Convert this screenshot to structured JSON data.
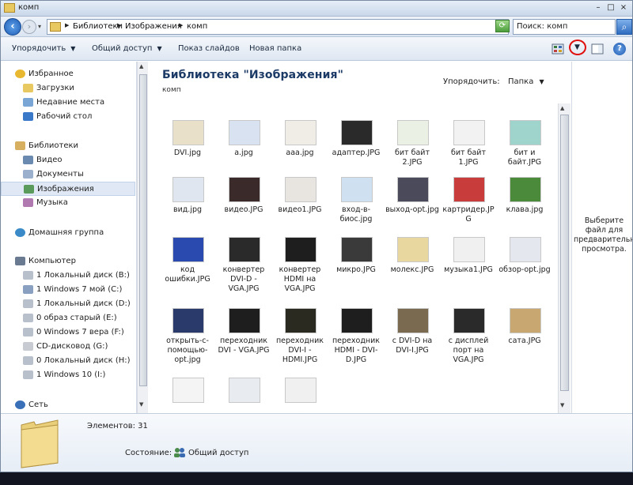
{
  "window": {
    "title": "комп"
  },
  "address": {
    "crumbs": [
      "Библиотеки",
      "Изображения",
      "комп"
    ],
    "search_placeholder": "Поиск: комп"
  },
  "toolbar": {
    "organize": "Упорядочить",
    "share": "Общий доступ",
    "slideshow": "Показ слайдов",
    "new_folder": "Новая папка"
  },
  "sidebar": {
    "items": [
      {
        "label": "Избранное",
        "icon": "star-icon"
      },
      {
        "label": "Загрузки",
        "icon": "downloads-folder-icon"
      },
      {
        "label": "Недавние места",
        "icon": "recent-places-icon"
      },
      {
        "label": "Рабочий стол",
        "icon": "desktop-icon"
      },
      {
        "label": "Библиотеки",
        "icon": "libraries-icon"
      },
      {
        "label": "Видео",
        "icon": "video-library-icon"
      },
      {
        "label": "Документы",
        "icon": "documents-library-icon"
      },
      {
        "label": "Изображения",
        "icon": "pictures-library-icon"
      },
      {
        "label": "Музыка",
        "icon": "music-library-icon"
      },
      {
        "label": "Домашняя группа",
        "icon": "homegroup-icon"
      },
      {
        "label": "Компьютер",
        "icon": "computer-icon"
      },
      {
        "label": "1 Локальный диск (B:)",
        "icon": "drive-icon"
      },
      {
        "label": "1 Windows 7 мой (C:)",
        "icon": "system-drive-icon"
      },
      {
        "label": "1 Локальный диск (D:)",
        "icon": "drive-icon"
      },
      {
        "label": "0 образ старый (E:)",
        "icon": "drive-icon"
      },
      {
        "label": "0 Windows 7 вера (F:)",
        "icon": "drive-icon"
      },
      {
        "label": "CD-дисковод (G:)",
        "icon": "cd-drive-icon"
      },
      {
        "label": "0 Локальный диск (H:)",
        "icon": "drive-icon"
      },
      {
        "label": "1 Windows 10 (I:)",
        "icon": "drive-icon"
      },
      {
        "label": "Сеть",
        "icon": "network-icon"
      }
    ]
  },
  "main": {
    "title": "Библиотека \"Изображения\"",
    "subtitle": "комп",
    "sort_label": "Упорядочить:",
    "sort_value": "Папка",
    "files": [
      {
        "name": "DVI.jpg",
        "thumb": "#e8e0c8"
      },
      {
        "name": "a.jpg",
        "thumb": "#d8e2f0"
      },
      {
        "name": "aaa.jpg",
        "thumb": "#f0ece6"
      },
      {
        "name": "адаптер.JPG",
        "thumb": "#2a2a2a"
      },
      {
        "name": "бит байт 2.JPG",
        "thumb": "#eaf0e4"
      },
      {
        "name": "бит байт 1.JPG",
        "thumb": "#f2f2f2"
      },
      {
        "name": "бит и байт.JPG",
        "thumb": "#9fd4cc"
      },
      {
        "name": "вид.jpg",
        "thumb": "#dfe6f0"
      },
      {
        "name": "видео.JPG",
        "thumb": "#3a2a2a"
      },
      {
        "name": "видео1.JPG",
        "thumb": "#e8e4e0"
      },
      {
        "name": "вход-в-биос.jpg",
        "thumb": "#cfe0f0"
      },
      {
        "name": "выход-opt.jpg",
        "thumb": "#4a4a5a"
      },
      {
        "name": "картридер.JPG",
        "thumb": "#c83c3c"
      },
      {
        "name": "клава.jpg",
        "thumb": "#4a8a3a"
      },
      {
        "name": "код ошибки.JPG",
        "thumb": "#2a4ab0"
      },
      {
        "name": "конвертер DVI-D - VGA.JPG",
        "thumb": "#2a2a2a"
      },
      {
        "name": "конвертер HDMI на VGA.JPG",
        "thumb": "#1e1e1e"
      },
      {
        "name": "микро.JPG",
        "thumb": "#3a3a3a"
      },
      {
        "name": "молекс.JPG",
        "thumb": "#e8d8a0"
      },
      {
        "name": "музыка1.JPG",
        "thumb": "#f0f0f0"
      },
      {
        "name": "обзор-opt.jpg",
        "thumb": "#e4e8ee"
      },
      {
        "name": "открыть-с-помощью-opt.jpg",
        "thumb": "#2a3a6a"
      },
      {
        "name": "переходник DVI - VGA.JPG",
        "thumb": "#1e1e1e"
      },
      {
        "name": "переходник DVI-I - HDMI.JPG",
        "thumb": "#2a2a20"
      },
      {
        "name": "переходник HDMI - DVI-D.JPG",
        "thumb": "#1e1e1e"
      },
      {
        "name": "с DVI-D на DVI-I.JPG",
        "thumb": "#7a6a50"
      },
      {
        "name": "с дисплей порт на VGA.JPG",
        "thumb": "#2a2a2a"
      },
      {
        "name": "сата.JPG",
        "thumb": "#c8a870"
      },
      {
        "name": "",
        "thumb": "#f4f4f4"
      },
      {
        "name": "",
        "thumb": "#e8ecf0"
      },
      {
        "name": "",
        "thumb": "#f0f0f0"
      }
    ]
  },
  "preview": {
    "text": "Выберите файл для предварительного просмотра."
  },
  "details": {
    "count": "Элементов: 31",
    "state_label": "Состояние:",
    "state_value": "Общий доступ"
  }
}
